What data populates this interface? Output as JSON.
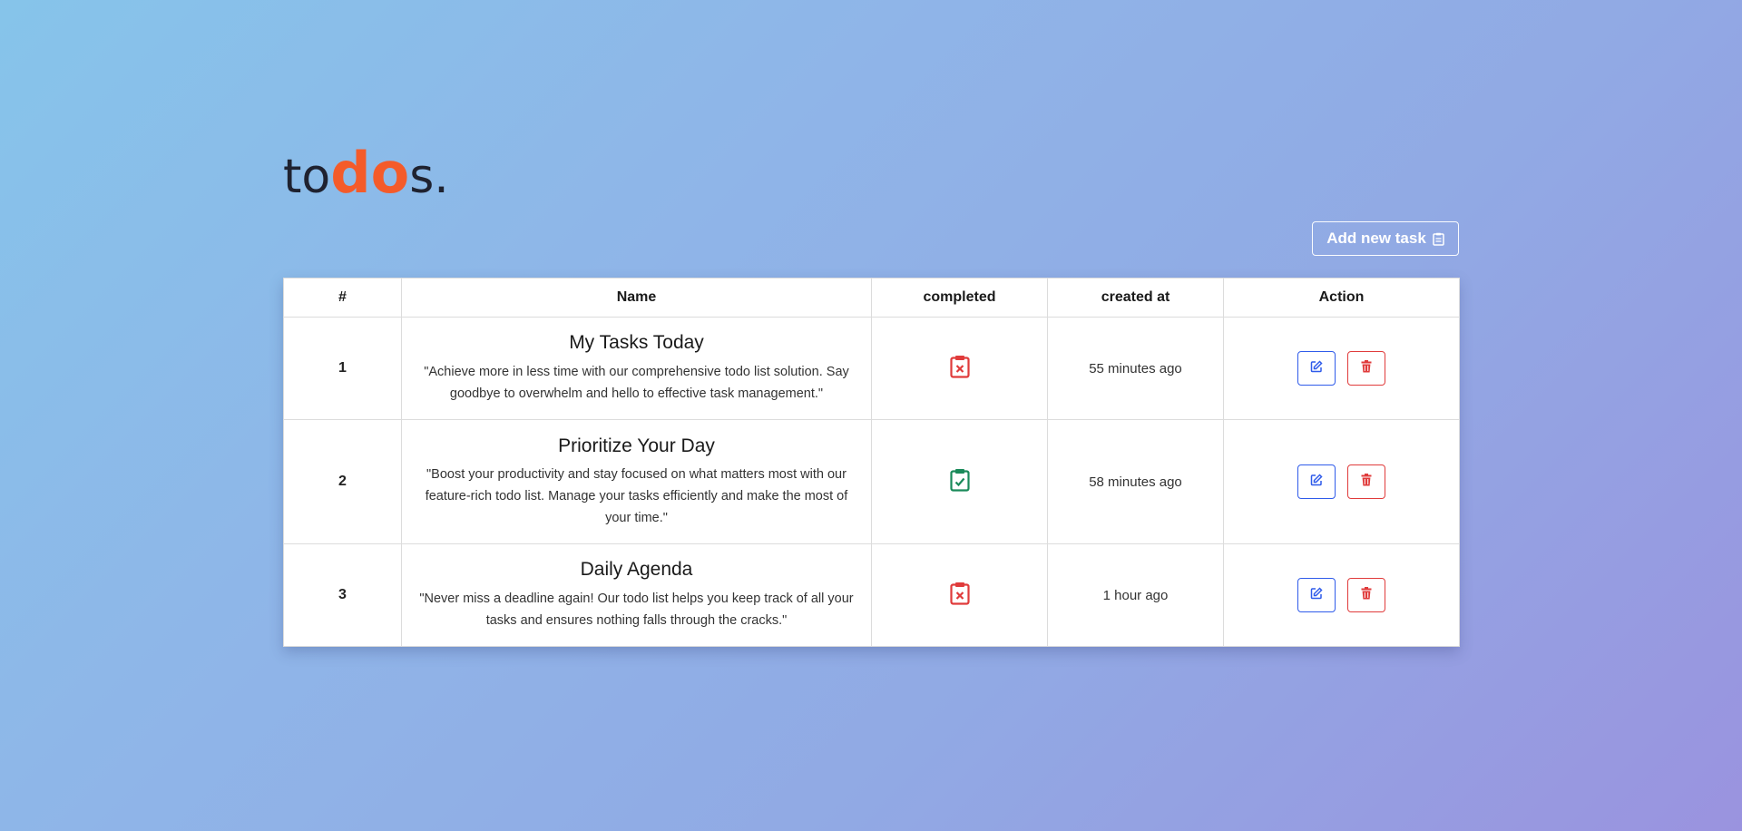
{
  "logo": {
    "part1": "to",
    "accent": "do",
    "part2": "s."
  },
  "add_button": {
    "label": "Add new task",
    "icon": "clipboard-icon"
  },
  "table": {
    "headers": [
      "#",
      "Name",
      "completed",
      "created at",
      "Action"
    ],
    "rows": [
      {
        "num": "1",
        "title": "My Tasks Today",
        "description": "\"Achieve more in less time with our comprehensive todo list solution. Say goodbye to overwhelm and hello to effective task management.\"",
        "completed": false,
        "created": "55 minutes ago"
      },
      {
        "num": "2",
        "title": "Prioritize Your Day",
        "description": "\"Boost your productivity and stay focused on what matters most with our feature-rich todo list. Manage your tasks efficiently and make the most of your time.\"",
        "completed": true,
        "created": "58 minutes ago"
      },
      {
        "num": "3",
        "title": "Daily Agenda",
        "description": "\"Never miss a deadline again! Our todo list helps you keep track of all your tasks and ensures nothing falls through the cracks.\"",
        "completed": false,
        "created": "1 hour ago"
      }
    ]
  },
  "colors": {
    "accent": "#f45b2a",
    "complete": "#1a8a5a",
    "incomplete": "#e03b3b",
    "edit": "#2f5bea",
    "delete": "#e03b3b"
  }
}
